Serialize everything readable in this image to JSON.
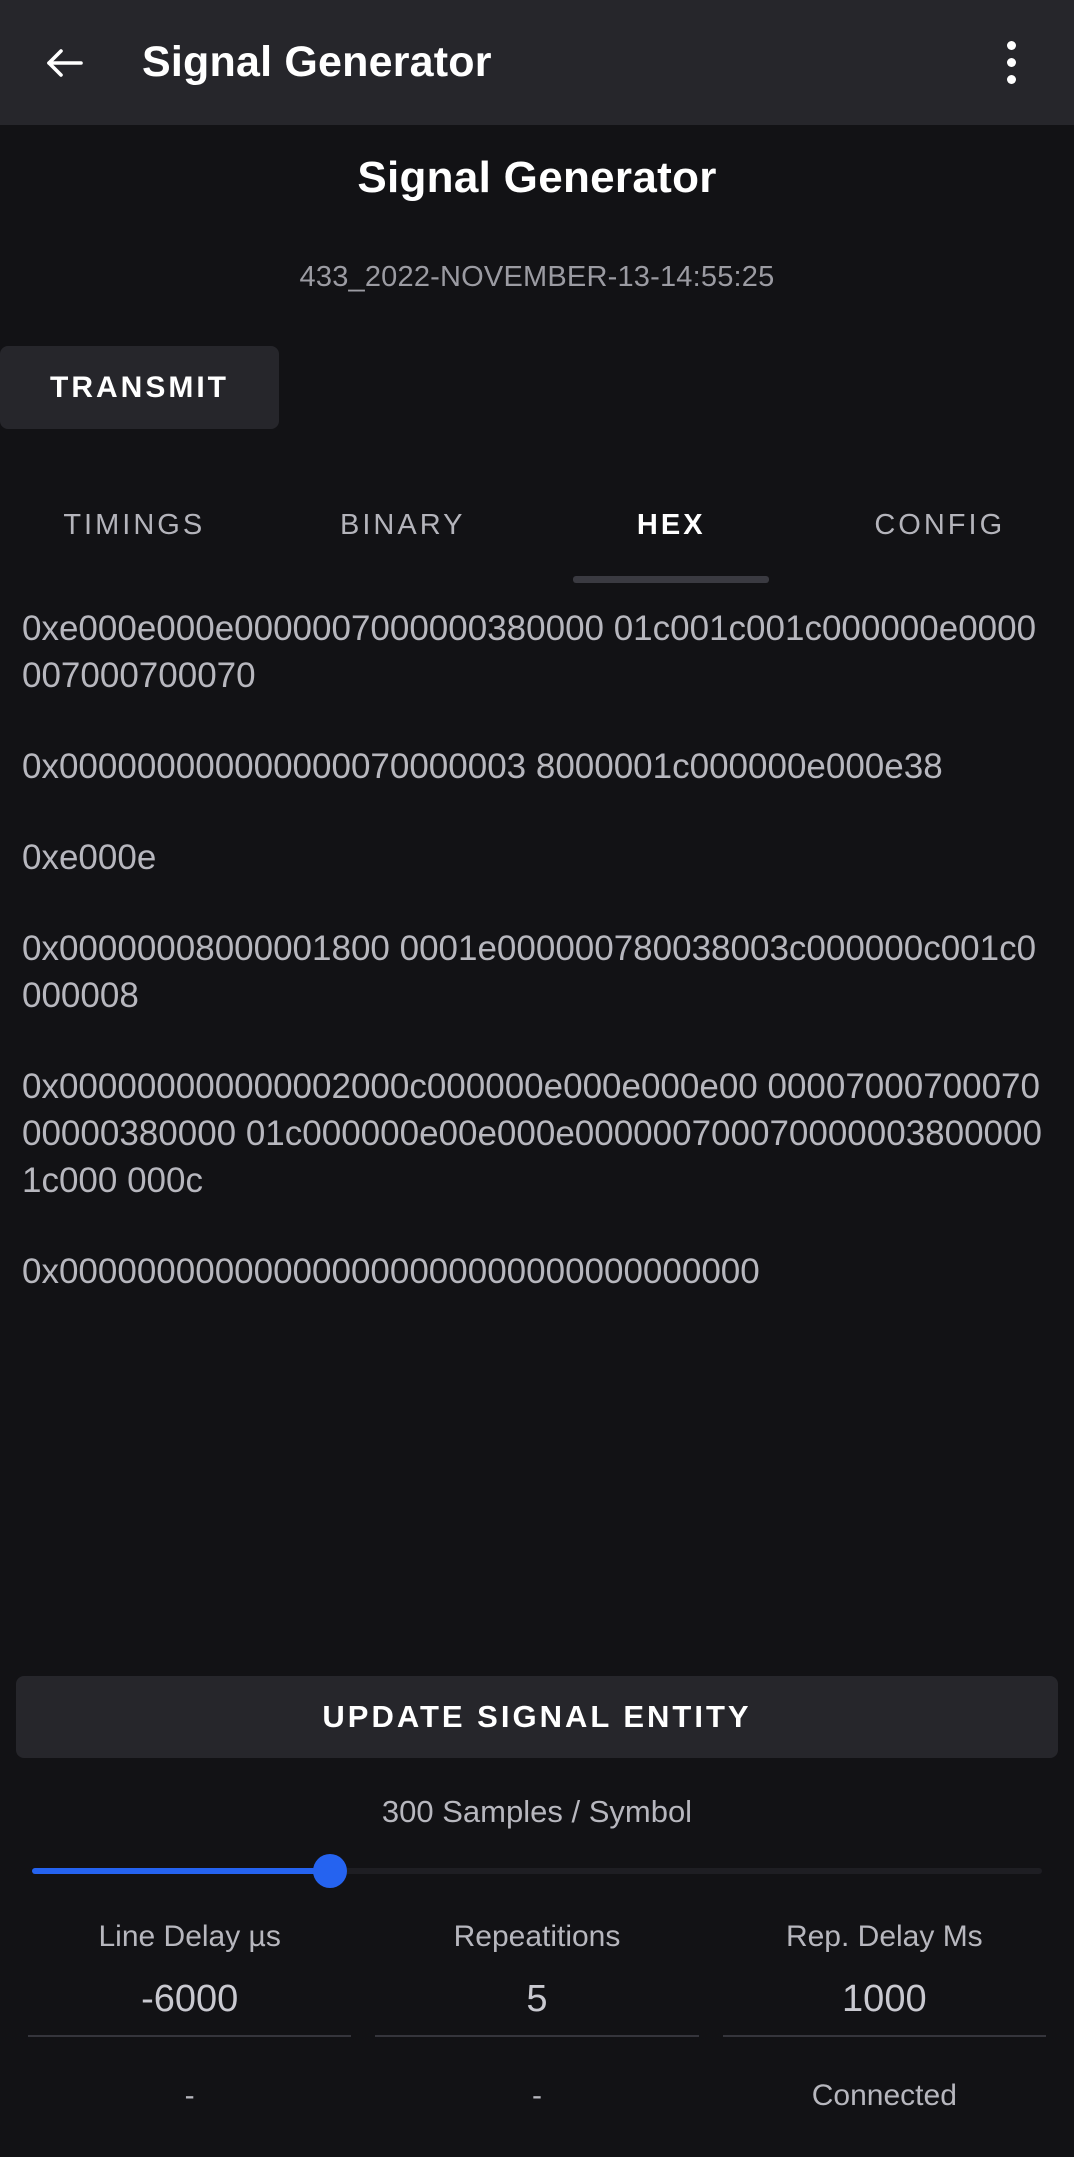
{
  "appbar": {
    "back_icon": "arrow-left-icon",
    "title": "Signal Generator",
    "overflow_icon": "more-vertical-icon"
  },
  "header": {
    "title": "Signal Generator",
    "subtitle": "433_2022-NOVEMBER-13-14:55:25"
  },
  "transmit": {
    "label": "TRANSMIT"
  },
  "tabs": [
    {
      "label": "TIMINGS",
      "active": false
    },
    {
      "label": "BINARY",
      "active": false
    },
    {
      "label": "HEX",
      "active": true
    },
    {
      "label": "CONFIG",
      "active": false
    }
  ],
  "hex": {
    "blocks": [
      "0xe000e000e0000007000000380000 01c001c001c000000e0000007000700070",
      "0x000000000000000070000003 8000001c000000e000e38",
      "0xe000e",
      "0x00000008000001800 0001e000000780038003c000000c001c0000008",
      "0x000000000000002000c000000e000e000e00 0000700070007000000380000 01c000000e00e000e0000007000700000038000001c000 000c",
      "0x000000000000000000000000000000000000"
    ]
  },
  "bottom": {
    "update_label": "UPDATE SIGNAL ENTITY",
    "samples_label": "300 Samples / Symbol",
    "slider": {
      "value": 300,
      "percent": 29.5,
      "accent_color": "#2563f0"
    },
    "fields": [
      {
        "label": "Line Delay µs",
        "value": "-6000",
        "status": "-"
      },
      {
        "label": "Repeatitions",
        "value": "5",
        "status": "-"
      },
      {
        "label": "Rep. Delay Ms",
        "value": "1000",
        "status": "Connected"
      }
    ]
  },
  "colors": {
    "background": "#121215",
    "appbar": "#26262b",
    "surface": "#26262b",
    "text_primary": "#ffffff",
    "text_secondary": "#b7b7be",
    "accent": "#2563f0"
  }
}
